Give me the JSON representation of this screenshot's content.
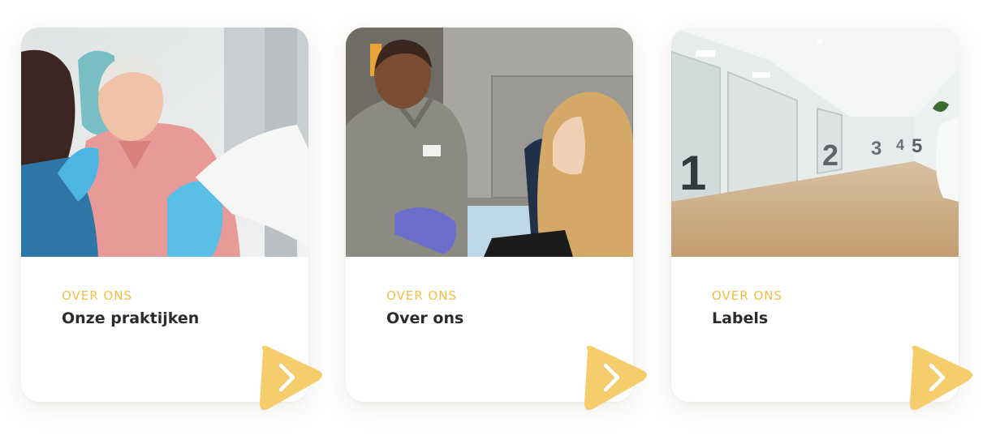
{
  "cards": [
    {
      "eyebrow": "OVER ONS",
      "title": "Onze praktijken",
      "image": "dentist-patient-photo",
      "button_icon": "chevron-right-icon"
    },
    {
      "eyebrow": "OVER ONS",
      "title": "Over ons",
      "image": "dental-staff-photo",
      "button_icon": "chevron-right-icon"
    },
    {
      "eyebrow": "OVER ONS",
      "title": "Labels",
      "image": "clinic-hallway-photo",
      "button_icon": "chevron-right-icon"
    }
  ],
  "hallway_room_numbers": [
    "1",
    "2",
    "3",
    "4",
    "5"
  ],
  "colors": {
    "accent": "#f3bc45",
    "arrow_button": "#f6cd6c",
    "title_text": "#2c2c2c",
    "card_background": "#ffffff"
  }
}
